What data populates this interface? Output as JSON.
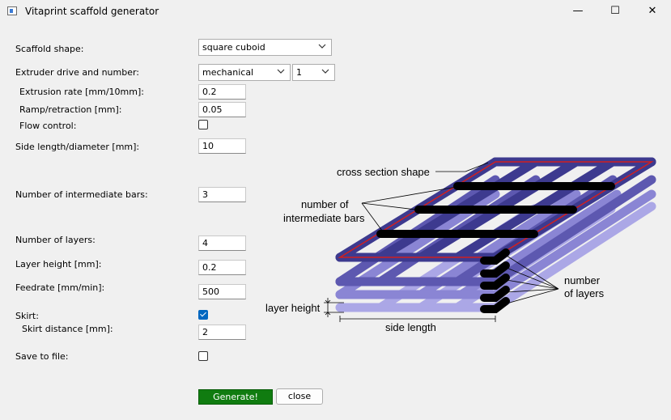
{
  "window": {
    "title": "Vitaprint scaffold generator",
    "minimize_glyph": "—",
    "maximize_glyph": "☐",
    "close_glyph": "✕"
  },
  "form": {
    "scaffold_shape": {
      "label": "Scaffold shape:",
      "value": "square cuboid"
    },
    "extruder": {
      "label": "Extruder drive and number:",
      "drive_value": "mechanical",
      "number_value": "1"
    },
    "extrusion_rate": {
      "label": "Extrusion rate [mm/10mm]:",
      "value": "0.2"
    },
    "ramp_retraction": {
      "label": "Ramp/retraction [mm]:",
      "value": "0.05"
    },
    "flow_control": {
      "label": "Flow control:",
      "checked": false
    },
    "side_length": {
      "label": "Side length/diameter [mm]:",
      "value": "10"
    },
    "intermediate_bars": {
      "label": "Number of intermediate bars:",
      "value": "3"
    },
    "layers": {
      "label": "Number of layers:",
      "value": "4"
    },
    "layer_height": {
      "label": "Layer height [mm]:",
      "value": "0.2"
    },
    "feedrate": {
      "label": "Feedrate [mm/min]:",
      "value": "500"
    },
    "skirt": {
      "label": "Skirt:",
      "checked": true
    },
    "skirt_distance": {
      "label": "Skirt distance [mm]:",
      "value": "2"
    },
    "save_to_file": {
      "label": "Save to file:",
      "checked": false
    }
  },
  "buttons": {
    "generate": "Generate!",
    "close": "close"
  },
  "diagram": {
    "cross_section": "cross section shape",
    "bars_line1": "number of",
    "bars_line2": "intermediate bars",
    "layers_line1": "number",
    "layers_line2": "of layers",
    "layer_height": "layer height",
    "side_length": "side length",
    "colors": {
      "layer_dark": "#3d3a8f",
      "layer_mid": "#5d58b0",
      "layer_light": "#8a85d4",
      "layer_lightest": "#aba7e6",
      "outline_red": "#d02020",
      "bar_black": "#000000"
    }
  }
}
